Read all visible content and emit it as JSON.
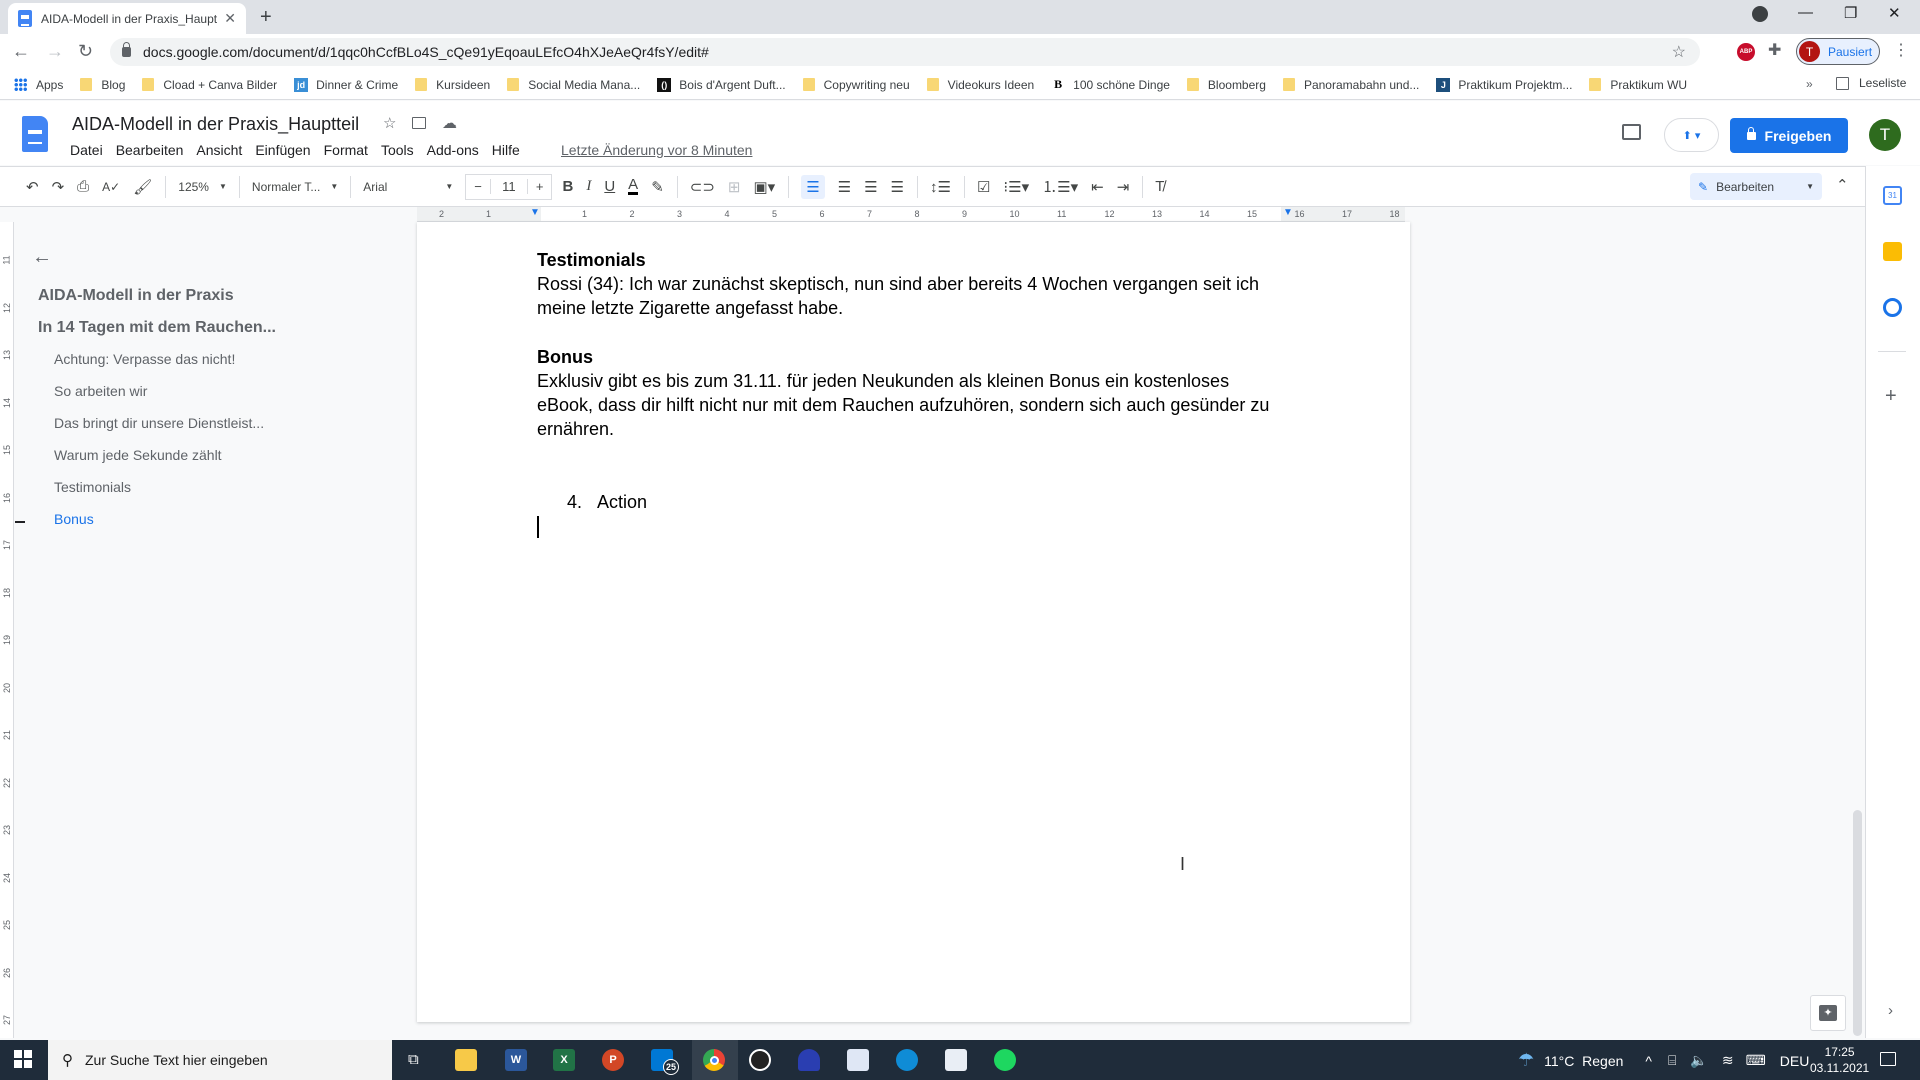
{
  "browser": {
    "tab_title": "AIDA-Modell in der Praxis_Haupt",
    "url": "docs.google.com/document/d/1qqc0hCcfBLo4S_cQe91yEqoauLEfcO4hXJeAeQr4fsY/edit#",
    "profile_initial": "T",
    "profile_status": "Pausiert",
    "abp_label": "ABP",
    "bookmarks": [
      {
        "label": "Apps",
        "icon": "apps-grid-icon"
      },
      {
        "label": "Blog",
        "icon": "folder-icon"
      },
      {
        "label": "Cload + Canva Bilder",
        "icon": "folder-icon"
      },
      {
        "label": "Dinner & Crime",
        "icon": "jd-favicon",
        "fav_text": "jd",
        "fav_color": "#3a8fd6"
      },
      {
        "label": "Kursideen",
        "icon": "folder-icon"
      },
      {
        "label": "Social Media Mana...",
        "icon": "folder-icon"
      },
      {
        "label": "Bois d'Argent Duft...",
        "icon": "bois-favicon",
        "fav_text": "()",
        "fav_color": "#111111"
      },
      {
        "label": "Copywriting neu",
        "icon": "folder-icon"
      },
      {
        "label": "Videokurs Ideen",
        "icon": "folder-icon"
      },
      {
        "label": "100 schöne Dinge",
        "icon": "b-favicon",
        "fav_text": "B",
        "fav_color": "#000000"
      },
      {
        "label": "Bloomberg",
        "icon": "folder-icon"
      },
      {
        "label": "Panoramabahn und...",
        "icon": "folder-icon"
      },
      {
        "label": "Praktikum Projektm...",
        "icon": "j-favicon",
        "fav_text": "J",
        "fav_color": "#1d4f7c"
      },
      {
        "label": "Praktikum WU",
        "icon": "folder-icon"
      }
    ],
    "more_bookmarks": "»",
    "reading_list": "Leseliste"
  },
  "docs": {
    "title": "AIDA-Modell in der Praxis_Hauptteil",
    "menu": [
      "Datei",
      "Bearbeiten",
      "Ansicht",
      "Einfügen",
      "Format",
      "Tools",
      "Add-ons",
      "Hilfe"
    ],
    "last_edit": "Letzte Änderung vor 8 Minuten",
    "share_label": "Freigeben",
    "user_initial": "T",
    "toolbar": {
      "zoom": "125%",
      "style": "Normaler T...",
      "font": "Arial",
      "font_size": "11",
      "minus": "−",
      "plus": "+",
      "mode": "Bearbeiten"
    },
    "colors": {
      "accent": "#1a73e8",
      "share_bg": "#1a73e8",
      "avatar": "#2e6b1e"
    }
  },
  "ruler": {
    "h_ticks": [
      "2",
      "1",
      "1",
      "2",
      "3",
      "4",
      "5",
      "6",
      "7",
      "8",
      "9",
      "10",
      "11",
      "12",
      "13",
      "14",
      "15",
      "16",
      "17",
      "18"
    ],
    "v_ticks": [
      "11",
      "12",
      "13",
      "14",
      "15",
      "16",
      "17",
      "18",
      "19",
      "20",
      "21",
      "22",
      "23",
      "24",
      "25",
      "26",
      "27"
    ]
  },
  "outline": {
    "items": [
      {
        "label": "AIDA-Modell in der Praxis",
        "level": 1,
        "active": false
      },
      {
        "label": "In 14 Tagen mit dem Rauchen...",
        "level": 1,
        "active": false
      },
      {
        "label": "Achtung: Verpasse das nicht!",
        "level": 2,
        "active": false
      },
      {
        "label": "So arbeiten wir",
        "level": 2,
        "active": false
      },
      {
        "label": "Das bringt dir unsere Dienstleist...",
        "level": 2,
        "active": false
      },
      {
        "label": "Warum jede Sekunde zählt",
        "level": 2,
        "active": false
      },
      {
        "label": "Testimonials",
        "level": 2,
        "active": false
      },
      {
        "label": "Bonus",
        "level": 2,
        "active": true
      }
    ]
  },
  "document": {
    "testimonials_heading": "Testimonials",
    "testimonials_line1": "Rossi (34): Ich war zunächst skeptisch, nun sind aber bereits 4 Wochen vergangen seit ich",
    "testimonials_line2": "meine letzte Zigarette angefasst habe.",
    "bonus_heading": "Bonus",
    "bonus_line1": "Exklusiv gibt es bis zum 31.11. für jeden Neukunden als kleinen Bonus ein kostenloses",
    "bonus_line2": "eBook, dass dir hilft nicht nur mit dem Rauchen aufzuhören, sondern sich auch gesünder zu",
    "bonus_line3": "ernähren.",
    "list_number": "4.",
    "list_item": "Action"
  },
  "taskbar": {
    "search_placeholder": "Zur Suche Text hier eingeben",
    "mail_badge": "25",
    "weather": "11°C  Regen",
    "language": "DEU",
    "time": "17:25",
    "date": "03.11.2021"
  }
}
